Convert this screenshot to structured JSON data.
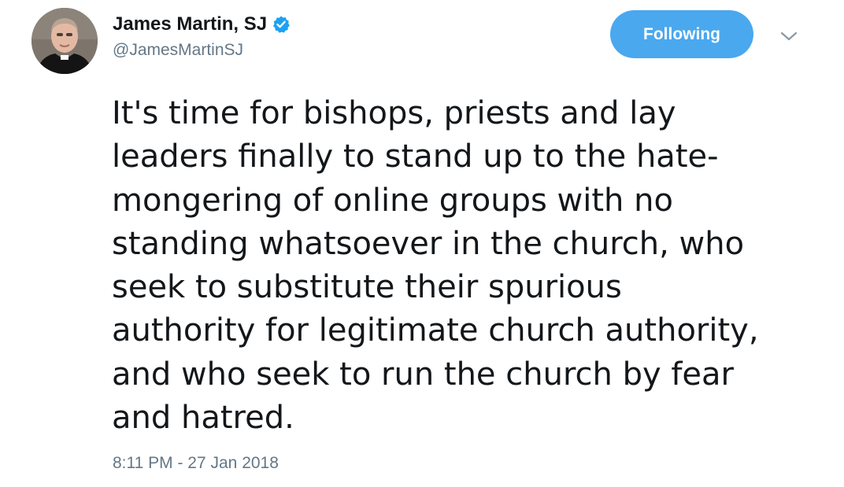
{
  "author": {
    "display_name": "James Martin, SJ",
    "handle": "@JamesMartinSJ",
    "verified": true,
    "avatar_icon": "profile-photo"
  },
  "actions": {
    "follow_label": "Following",
    "follow_color": "#4aa8ef",
    "menu_icon": "chevron-down-icon"
  },
  "tweet": {
    "lines": [
      "It's time for bishops, priests and lay",
      "leaders finally to stand up to the hate-",
      "mongering of online groups with no",
      "standing whatsoever in the church, who",
      "seek to substitute their spurious",
      "authority for legitimate church authority,",
      "and who seek to run the church by fear",
      "and hatred."
    ],
    "timestamp": "8:11 PM - 27 Jan 2018"
  },
  "colors": {
    "text": "#14171a",
    "secondary_text": "#657786",
    "verified_badge": "#1da1f2"
  }
}
